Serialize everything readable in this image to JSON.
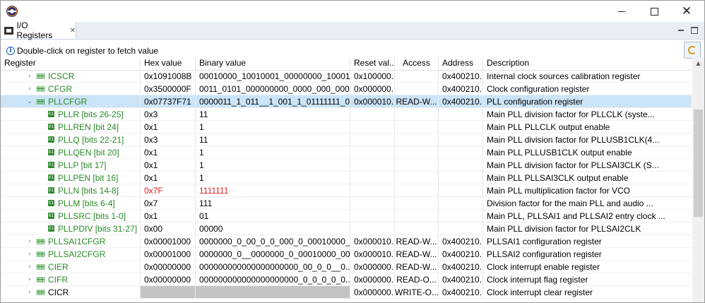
{
  "window": {
    "icon": "eclipse-icon",
    "controls": {
      "minimize": "minimize-icon",
      "maximize": "maximize-icon",
      "close": "✕"
    }
  },
  "tab": {
    "label": "I/O Registers",
    "close": "✕"
  },
  "info": {
    "icon": "info-icon",
    "text": "Double-click on register to fetch value"
  },
  "columns": [
    "Register",
    "Hex value",
    "Binary value",
    "Reset val...",
    "Access",
    "Address",
    "Description"
  ],
  "rows": [
    {
      "kind": "register",
      "expanded": false,
      "name": "ICSCR",
      "hex": "0x1091008B",
      "bin": "00010000_10010001_00000000_100010...",
      "reset": "0x100000...",
      "access": "",
      "address": "0x400210...",
      "desc": "Internal clock sources calibration register"
    },
    {
      "kind": "register",
      "expanded": false,
      "name": "CFGR",
      "hex": "0x3500000F",
      "bin": "0011_0101_000000000_0000_000_0000_...",
      "reset": "0x000000...",
      "access": "",
      "address": "0x400210...",
      "desc": "Clock configuration register"
    },
    {
      "kind": "register",
      "expanded": true,
      "selected": true,
      "name": "PLLCFGR",
      "hex": "0x07737F71",
      "bin": "0000011_1_011__1_001_1_01111111_01...",
      "reset": "0x000010...",
      "access": "READ-W...",
      "address": "0x400210...",
      "desc": "PLL configuration register"
    },
    {
      "kind": "field",
      "name": "PLLR [bits 26-25]",
      "hex": "0x3",
      "bin": "11",
      "desc": "Main PLL division factor for PLLCLK (syste..."
    },
    {
      "kind": "field",
      "name": "PLLREN [bit 24]",
      "hex": "0x1",
      "bin": "1",
      "desc": "Main PLL PLLCLK output enable"
    },
    {
      "kind": "field",
      "name": "PLLQ [bits 22-21]",
      "hex": "0x3",
      "bin": "11",
      "desc": "Main PLL division factor for PLLUSB1CLK(4..."
    },
    {
      "kind": "field",
      "name": "PLLQEN [bit 20]",
      "hex": "0x1",
      "bin": "1",
      "desc": "Main PLL PLLUSB1CLK output enable"
    },
    {
      "kind": "field",
      "name": "PLLP [bit 17]",
      "hex": "0x1",
      "bin": "1",
      "desc": "Main PLL division factor for PLLSAI3CLK (S..."
    },
    {
      "kind": "field",
      "name": "PLLPEN [bit 16]",
      "hex": "0x1",
      "bin": "1",
      "desc": "Main PLL PLLSAI3CLK output enable"
    },
    {
      "kind": "field",
      "changed": true,
      "name": "PLLN [bits 14-8]",
      "hex": "0x7F",
      "bin": "1111111",
      "desc": "Main PLL multiplication factor for VCO"
    },
    {
      "kind": "field",
      "name": "PLLM [bits 6-4]",
      "hex": "0x7",
      "bin": "111",
      "desc": "Division factor for the main PLL and audio ..."
    },
    {
      "kind": "field",
      "name": "PLLSRC [bits 1-0]",
      "hex": "0x1",
      "bin": "01",
      "desc": "Main PLL, PLLSAI1 and PLLSAI2 entry clock ..."
    },
    {
      "kind": "field",
      "name": "PLLPDIV [bits 31-27]",
      "hex": "0x00",
      "bin": "00000",
      "desc": "Main PLL division factor for PLLSAI2CLK"
    },
    {
      "kind": "register",
      "expanded": false,
      "name": "PLLSAI1CFGR",
      "hex": "0x00001000",
      "bin": "0000000_0_00_0_0_000_0_00010000_000...",
      "reset": "0x000010...",
      "access": "READ-W...",
      "address": "0x400210...",
      "desc": "PLLSAI1 configuration register"
    },
    {
      "kind": "register",
      "expanded": false,
      "name": "PLLSAI2CFGR",
      "hex": "0x00001000",
      "bin": "0000000_0__0000000_0_00010000_000...",
      "reset": "0x000010...",
      "access": "READ-W...",
      "address": "0x400210...",
      "desc": "PLLSAI2 configuration register"
    },
    {
      "kind": "register",
      "expanded": false,
      "name": "CIER",
      "hex": "0x00000000",
      "bin": "000000000000000000000_00_0_0__0...",
      "reset": "0x000000...",
      "access": "READ-W...",
      "address": "0x400210...",
      "desc": "Clock interrupt enable register"
    },
    {
      "kind": "register",
      "expanded": false,
      "name": "CIFR",
      "hex": "0x00000000",
      "bin": "000000000000000000000_0_0_0_0_0...",
      "reset": "0x000000...",
      "access": "READ-O...",
      "address": "0x400210...",
      "desc": "Clock interrupt flag register"
    },
    {
      "kind": "register",
      "expanded": false,
      "unread": true,
      "name": "CICR",
      "hex": "",
      "bin": "",
      "reset": "0x000000...",
      "access": "WRITE-O...",
      "address": "0x400210...",
      "desc": "Clock interrupt clear register"
    }
  ],
  "colors": {
    "selection": "#cce4f7",
    "changed": "#e02020",
    "name": "#2a8a2a",
    "unread_cell": "#c4c4c4"
  }
}
